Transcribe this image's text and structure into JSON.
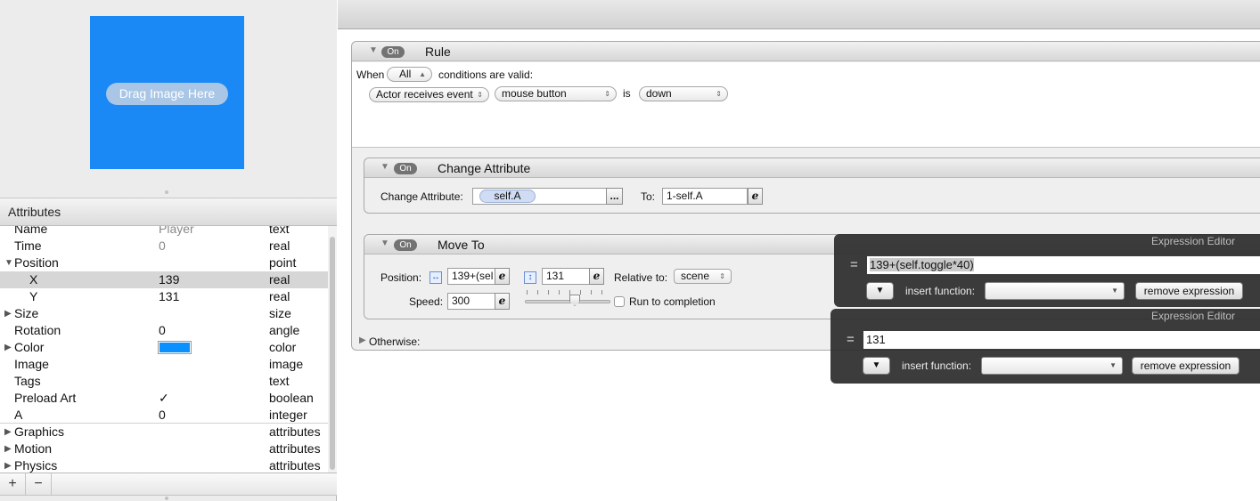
{
  "preview": {
    "drag_label": "Drag Image Here",
    "color": "#1a88f5"
  },
  "attributes": {
    "header": "Attributes",
    "rows": [
      {
        "name": "Name",
        "value": "Player",
        "type": "text"
      },
      {
        "name": "Time",
        "value": "0",
        "type": "real"
      },
      {
        "name": "Position",
        "value": "",
        "type": "point",
        "expanded": true
      },
      {
        "name": "X",
        "value": "139",
        "type": "real",
        "selected": true
      },
      {
        "name": "Y",
        "value": "131",
        "type": "real"
      },
      {
        "name": "Size",
        "value": "",
        "type": "size"
      },
      {
        "name": "Rotation",
        "value": "0",
        "type": "angle"
      },
      {
        "name": "Color",
        "value": "",
        "type": "color",
        "swatch": "#0a91ff"
      },
      {
        "name": "Image",
        "value": "",
        "type": "image"
      },
      {
        "name": "Tags",
        "value": "",
        "type": "text"
      },
      {
        "name": "Preload Art",
        "value": "✓",
        "type": "boolean"
      },
      {
        "name": "A",
        "value": "0",
        "type": "integer"
      },
      {
        "name": "Graphics",
        "value": "",
        "type": "attributes"
      },
      {
        "name": "Motion",
        "value": "",
        "type": "attributes"
      },
      {
        "name": "Physics",
        "value": "",
        "type": "attributes"
      }
    ],
    "add_label": "+",
    "remove_label": "−"
  },
  "rule": {
    "on_label": "On",
    "title": "Rule",
    "when_label": "When",
    "when_value": "All",
    "conditions_label": "conditions are valid:",
    "condition": {
      "subject": "Actor receives event",
      "event": "mouse button",
      "is_label": "is",
      "state": "down"
    },
    "otherwise_label": "Otherwise:"
  },
  "change_attribute": {
    "on_label": "On",
    "title": "Change Attribute",
    "field_label": "Change Attribute:",
    "attribute": "self.A",
    "browse_label": "...",
    "to_label": "To:",
    "to_value": "1-self.A"
  },
  "move_to": {
    "on_label": "On",
    "title": "Move To",
    "position_label": "Position:",
    "x_value": "139+(sel",
    "y_value": "131",
    "relative_label": "Relative to:",
    "relative_value": "scene",
    "speed_label": "Speed:",
    "speed_value": "300",
    "run_label": "Run to completion"
  },
  "expr_editor_x": {
    "title": "Expression Editor",
    "eq": "=",
    "expression": "139+(self.toggle*40)",
    "menu_glyph": "▼",
    "insert_label": "insert function:",
    "remove_label": "remove expression"
  },
  "expr_editor_y": {
    "title": "Expression Editor",
    "eq": "=",
    "expression": "131",
    "menu_glyph": "▼",
    "insert_label": "insert function:",
    "remove_label": "remove expression"
  }
}
